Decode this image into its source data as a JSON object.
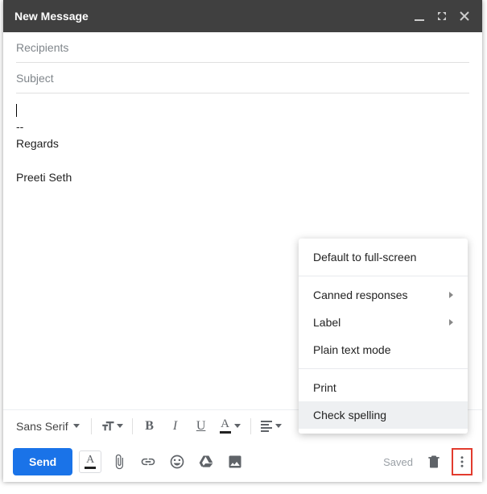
{
  "window": {
    "title": "New Message"
  },
  "fields": {
    "recipients_placeholder": "Recipients",
    "subject_placeholder": "Subject"
  },
  "body": {
    "sig_divider": "--",
    "sig_line1": "Regards",
    "sig_line2": "Preeti Seth"
  },
  "format_bar": {
    "font_family": "Sans Serif",
    "size_icon": "text-size-icon",
    "bold": "B",
    "italic": "I",
    "underline": "U",
    "color": "A"
  },
  "send_bar": {
    "send_label": "Send",
    "fmt_a": "A",
    "saved_label": "Saved"
  },
  "menu": {
    "default_fullscreen": "Default to full-screen",
    "canned": "Canned responses",
    "label": "Label",
    "plain_text": "Plain text mode",
    "print": "Print",
    "check_spelling": "Check spelling"
  }
}
